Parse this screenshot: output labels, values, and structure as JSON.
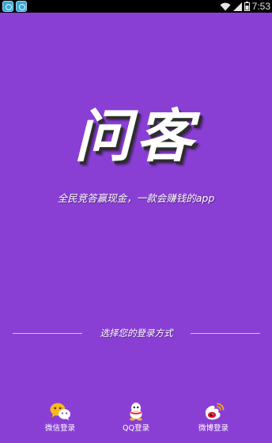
{
  "status_bar": {
    "time": "7:53",
    "icons": [
      "app-notification-icon",
      "app-notification-icon",
      "wifi-icon",
      "signal-icon",
      "battery-icon"
    ]
  },
  "brand": {
    "title": "问客",
    "slogan": "全民竞答赢现金，一款会赚钱的app"
  },
  "login": {
    "prompt": "选择您的登录方式",
    "options": [
      {
        "label": "微信登录",
        "icon": "wechat-icon"
      },
      {
        "label": "QQ登录",
        "icon": "qq-icon"
      },
      {
        "label": "微博登录",
        "icon": "weibo-icon"
      }
    ]
  },
  "colors": {
    "background": "#8a3fd4",
    "status_bar": "#000000",
    "text": "#ffffff",
    "wechat_yellow": "#f6b91f",
    "weibo_red": "#e6162d",
    "weibo_orange": "#f8a51c"
  }
}
